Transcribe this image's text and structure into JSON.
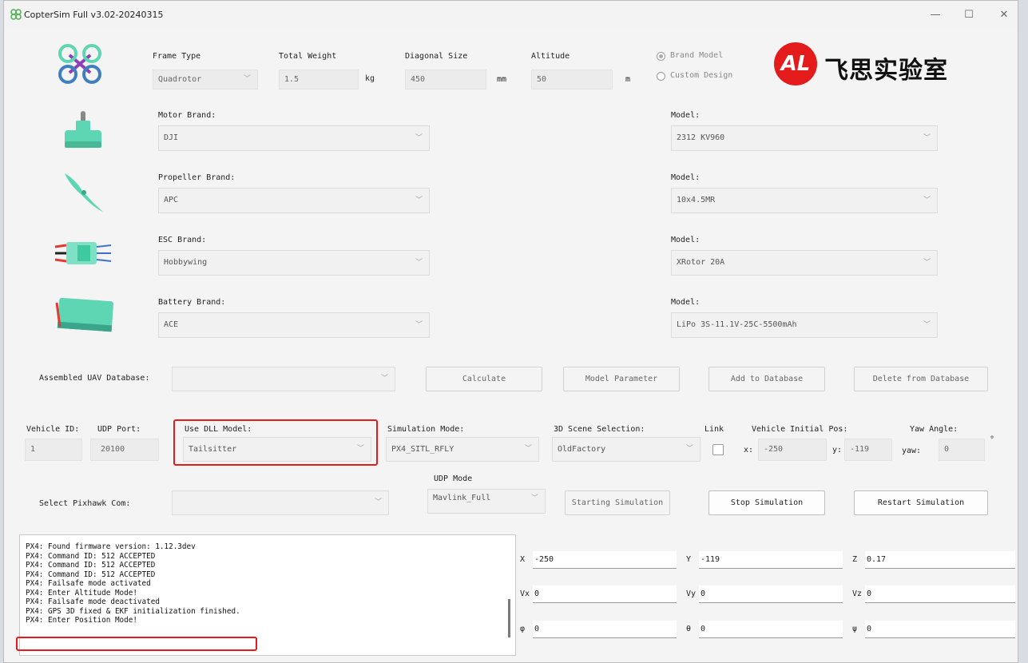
{
  "window": {
    "title": "CopterSim Full v3.02-20240315",
    "minimize": "—",
    "maximize": "☐",
    "close": "✕"
  },
  "top_row": {
    "frame_type": {
      "label": "Frame Type",
      "value": "Quadrotor"
    },
    "total_weight": {
      "label": "Total Weight",
      "value": "1.5",
      "unit": "kg"
    },
    "diagonal_size": {
      "label": "Diagonal Size",
      "value": "450",
      "unit": "mm"
    },
    "altitude": {
      "label": "Altitude",
      "value": "50",
      "unit": "m"
    },
    "radio_brand": {
      "label": "Brand Model",
      "selected": true
    },
    "radio_custom": {
      "label": "Custom Design",
      "selected": false
    }
  },
  "logo": {
    "glyph": "AL",
    "text": "飞思实验室",
    "color": "#e31b1b"
  },
  "components": [
    {
      "brand_label": "Motor Brand:",
      "brand_value": "DJI",
      "model_label": "Model:",
      "model_value": "2312 KV960",
      "icon": "motor-icon"
    },
    {
      "brand_label": "Propeller Brand:",
      "brand_value": "APC",
      "model_label": "Model:",
      "model_value": "10x4.5MR",
      "icon": "propeller-icon"
    },
    {
      "brand_label": "ESC Brand:",
      "brand_value": "Hobbywing",
      "model_label": "Model:",
      "model_value": "XRotor 20A",
      "icon": "esc-icon"
    },
    {
      "brand_label": "Battery Brand:",
      "brand_value": "ACE",
      "model_label": "Model:",
      "model_value": "LiPo 3S-11.1V-25C-5500mAh",
      "icon": "battery-icon"
    }
  ],
  "database": {
    "label": "Assembled UAV Database:",
    "value": "",
    "buttons": {
      "calculate": "Calculate",
      "model_parameter": "Model Parameter",
      "add": "Add to Database",
      "delete": "Delete from Database"
    }
  },
  "sim": {
    "vehicle_id": {
      "label": "Vehicle ID:",
      "value": "1"
    },
    "udp_port": {
      "label": "UDP Port:",
      "value": "20100"
    },
    "dll_model": {
      "label": "Use DLL Model:",
      "value": "Tailsitter"
    },
    "sim_mode": {
      "label": "Simulation Mode:",
      "value": "PX4_SITL_RFLY"
    },
    "scene": {
      "label": "3D Scene Selection:",
      "value": "OldFactory"
    },
    "link": {
      "label": "Link"
    },
    "init_pos": {
      "label": "Vehicle Initial Pos:",
      "x_label": "x:",
      "x": "-250",
      "y_label": "y:",
      "y": "-119"
    },
    "yaw": {
      "label": "Yaw Angle:",
      "yaw_label": "yaw:",
      "value": "0",
      "unit": "°"
    }
  },
  "controls": {
    "pixhawk": {
      "label": "Select Pixhawk Com:",
      "value": ""
    },
    "udp_mode": {
      "label": "UDP Mode",
      "value": "Mavlink_Full"
    },
    "start": "Starting Simulation",
    "stop": "Stop Simulation",
    "restart": "Restart Simulation"
  },
  "log": [
    "PX4: Found firmware version: 1.12.3dev",
    "PX4: Command ID: 512 ACCEPTED",
    "PX4: Command ID: 512 ACCEPTED",
    "PX4: Command ID: 512 ACCEPTED",
    "PX4: Failsafe mode activated",
    "PX4: Enter Altitude Mode!",
    "PX4: Failsafe mode deactivated",
    "PX4: GPS 3D fixed & EKF initialization finished.",
    "PX4: Enter Position Mode!"
  ],
  "state": {
    "row1": [
      {
        "label": "X",
        "value": "-250"
      },
      {
        "label": "Y",
        "value": "-119"
      },
      {
        "label": "Z",
        "value": "0.17"
      }
    ],
    "row2": [
      {
        "label": "Vx",
        "value": "0"
      },
      {
        "label": "Vy",
        "value": "0"
      },
      {
        "label": "Vz",
        "value": "0"
      }
    ],
    "row3": [
      {
        "label": "φ",
        "value": "0"
      },
      {
        "label": "θ",
        "value": "0"
      },
      {
        "label": "ψ",
        "value": "0"
      }
    ]
  },
  "colors": {
    "accent_red": "#e31b1b",
    "mint": "#5ed6b4"
  }
}
